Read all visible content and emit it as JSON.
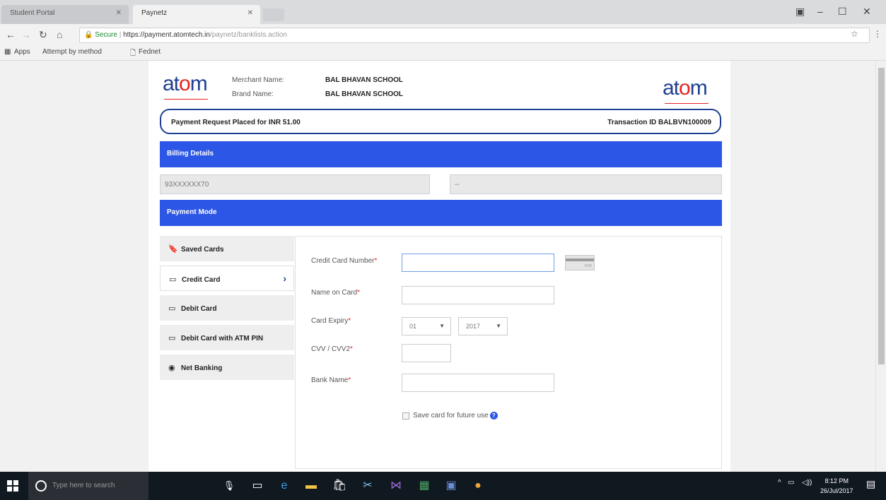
{
  "browser": {
    "tabs": [
      {
        "label": "Student Portal",
        "active": false
      },
      {
        "label": "Paynetz",
        "active": true
      }
    ],
    "secure_label": "Secure",
    "url_main": "https://payment.atomtech.in",
    "url_path": "/paynetz/banklists.action",
    "bookmarks": [
      "Apps",
      "Attempt by method",
      "Fednet"
    ]
  },
  "header": {
    "logo_prefix": "at",
    "logo_o": "o",
    "logo_suffix": "m",
    "merchant_name_label": "Merchant Name:",
    "merchant_name_value": "BAL BHAVAN SCHOOL",
    "brand_name_label": "Brand Name:",
    "brand_name_value": "BAL BHAVAN SCHOOL"
  },
  "request": {
    "text": "Payment Request Placed for INR 51.00",
    "transaction": "Transaction ID BALBVN100009"
  },
  "billing": {
    "title": "Billing Details",
    "phone": "93XXXXXX70",
    "email": "--"
  },
  "payment_mode": {
    "title": "Payment Mode",
    "items": [
      {
        "label": "Saved Cards",
        "icon": "bookmark-icon"
      },
      {
        "label": "Credit Card",
        "icon": "card-icon"
      },
      {
        "label": "Debit Card",
        "icon": "card-icon"
      },
      {
        "label": "Debit Card with ATM PIN",
        "icon": "card-icon"
      },
      {
        "label": "Net Banking",
        "icon": "globe-icon"
      }
    ],
    "active_index": 1
  },
  "form": {
    "card_number_label": "Credit Card Number",
    "name_label": "Name on Card",
    "expiry_label": "Card Expiry",
    "expiry_month": "01",
    "expiry_year": "2017",
    "cvv_label": "CVV / CVV2",
    "bank_label": "Bank Name",
    "save_label": "Save card for future use",
    "card_icon_text": "CVV"
  },
  "taskbar": {
    "search_placeholder": "Type here to search",
    "time": "8:12 PM",
    "date": "26/Jul/2017"
  },
  "colors": {
    "brand_blue": "#2c56e5",
    "logo_navy": "#1e3f91",
    "logo_red": "#e52421"
  }
}
